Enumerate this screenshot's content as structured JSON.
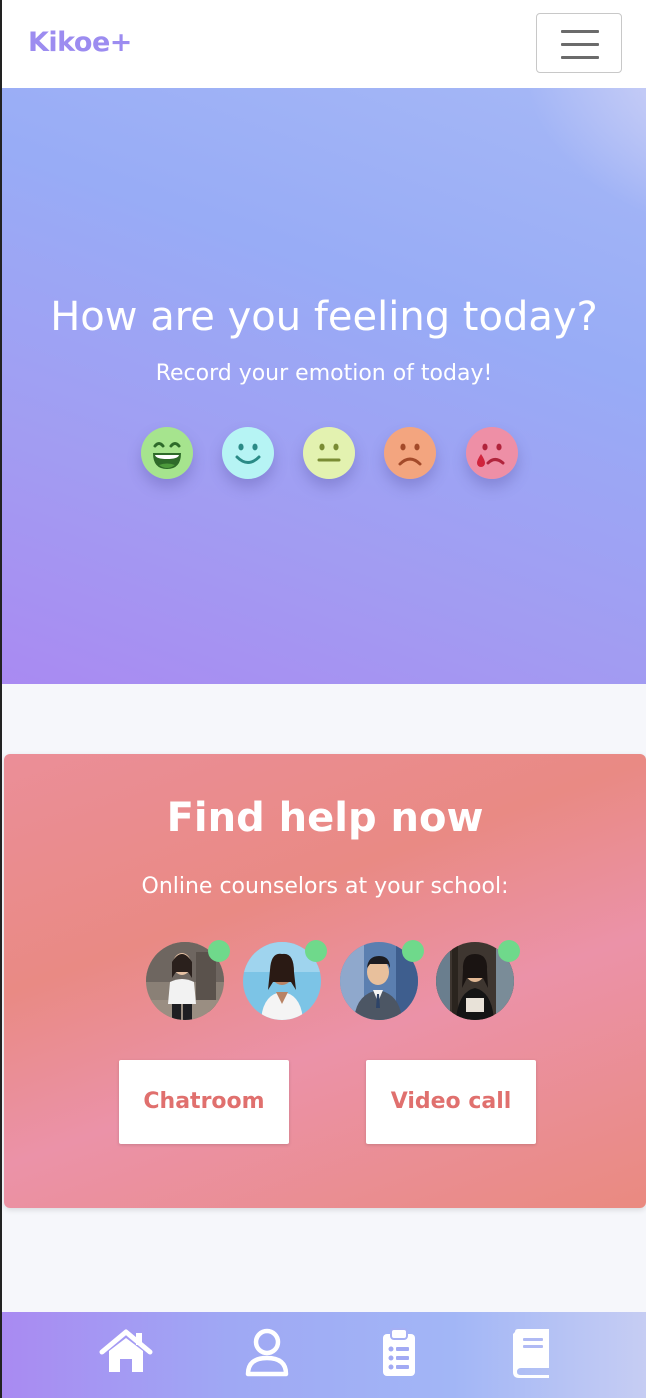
{
  "app": {
    "brand": "Kikoe+"
  },
  "hero": {
    "title": "How are you feeling today?",
    "subtitle": "Record your emotion of today!",
    "emotions": [
      {
        "name": "very-happy",
        "color": "#a6e48e"
      },
      {
        "name": "happy",
        "color": "#b6f4f4"
      },
      {
        "name": "neutral",
        "color": "#e3f2b0"
      },
      {
        "name": "sad",
        "color": "#f3a57f"
      },
      {
        "name": "crying",
        "color": "#ee8fa6"
      }
    ]
  },
  "help": {
    "title": "Find help now",
    "subtitle": "Online counselors at your school:",
    "online_color": "#6fd98b",
    "chatroom_label": "Chatroom",
    "video_call_label": "Video call"
  },
  "bottom_nav": {
    "items": [
      {
        "icon": "home-icon"
      },
      {
        "icon": "user-icon"
      },
      {
        "icon": "clipboard-list-icon"
      },
      {
        "icon": "book-icon"
      }
    ]
  }
}
